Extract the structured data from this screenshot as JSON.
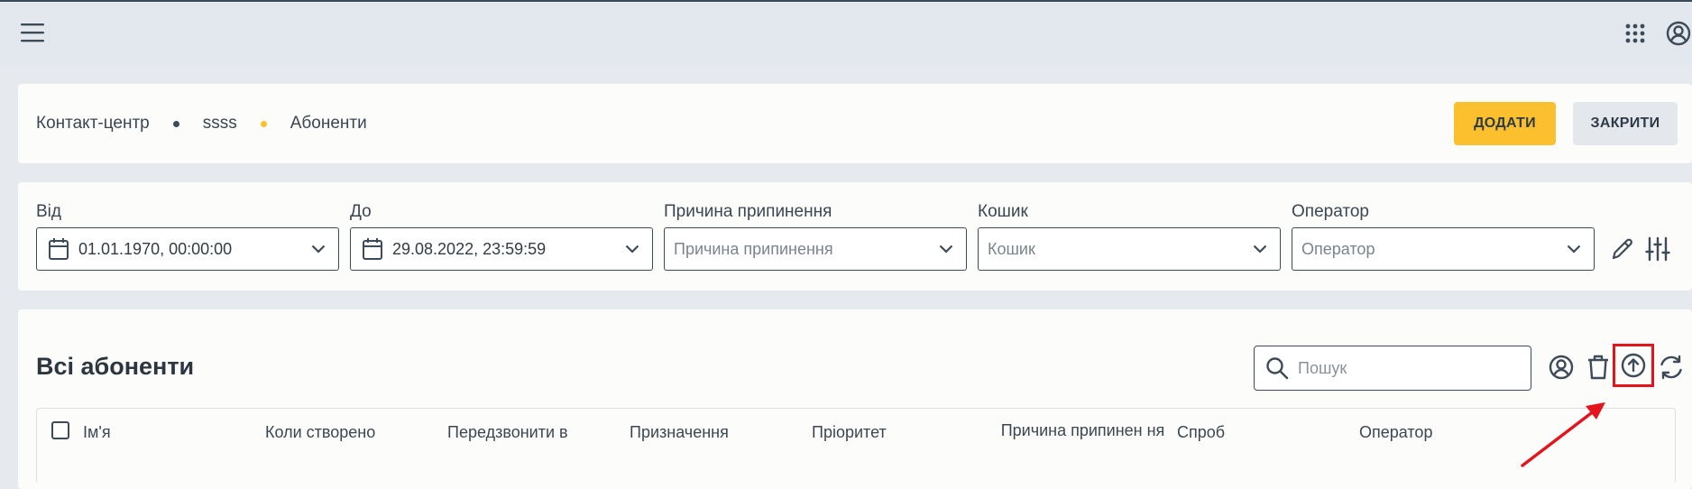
{
  "breadcrumb": {
    "items": [
      "Контакт-центр",
      "ssss",
      "Абоненти"
    ]
  },
  "actions": {
    "add_label": "ДОДАТИ",
    "close_label": "ЗАКРИТИ"
  },
  "filters": {
    "from": {
      "label": "Від",
      "value": "01.01.1970, 00:00:00"
    },
    "to": {
      "label": "До",
      "value": "29.08.2022, 23:59:59"
    },
    "reason": {
      "label": "Причина припинення",
      "placeholder": "Причина припинення"
    },
    "basket": {
      "label": "Кошик",
      "placeholder": "Кошик"
    },
    "operator": {
      "label": "Оператор",
      "placeholder": "Оператор"
    }
  },
  "list": {
    "title": "Всі абоненти",
    "search_placeholder": "Пошук",
    "columns": [
      "Ім'я",
      "Коли створено",
      "Передзвонити в",
      "Призначення",
      "Пріоритет",
      "Причина припинен ня",
      "Спроб",
      "Оператор"
    ]
  },
  "icons": [
    "menu-icon",
    "apps-grid-icon",
    "account-icon",
    "calendar-icon",
    "chevron-down-icon",
    "pencil-icon",
    "sliders-icon",
    "search-icon",
    "user-circle-icon",
    "trash-icon",
    "upload-cloud-icon",
    "refresh-icon",
    "arrow-icon"
  ],
  "colors": {
    "accent": "#fcc02e",
    "highlight": "#e3141b",
    "text": "#333b45",
    "border": "#3d4a58"
  }
}
